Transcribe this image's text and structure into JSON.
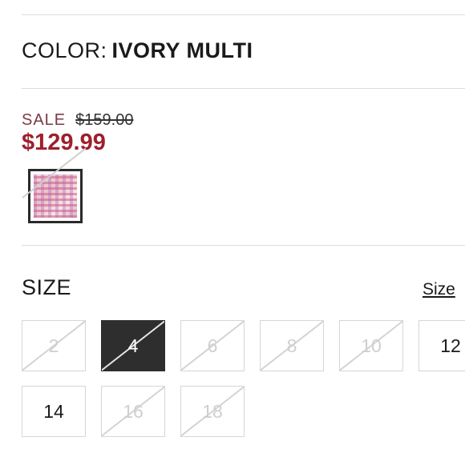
{
  "color": {
    "label": "COLOR:",
    "value": "IVORY MULTI"
  },
  "pricing": {
    "sale_label": "SALE",
    "original_price": "$159.00",
    "sale_price": "$129.99"
  },
  "swatch": {
    "name": "ivory-multi-swatch",
    "selected": true,
    "unavailable": true
  },
  "size": {
    "title": "SIZE",
    "guide_label": "Size",
    "options": [
      {
        "label": "2",
        "available": false,
        "selected": false
      },
      {
        "label": "4",
        "available": false,
        "selected": true
      },
      {
        "label": "6",
        "available": false,
        "selected": false
      },
      {
        "label": "8",
        "available": false,
        "selected": false
      },
      {
        "label": "10",
        "available": false,
        "selected": false
      },
      {
        "label": "12",
        "available": true,
        "selected": false
      },
      {
        "label": "14",
        "available": true,
        "selected": false
      },
      {
        "label": "16",
        "available": false,
        "selected": false
      },
      {
        "label": "18",
        "available": false,
        "selected": false
      }
    ]
  },
  "colors": {
    "sale_red": "#9e1f2b",
    "sale_label": "#7d3a47",
    "selected_bg": "#2e2e2e"
  }
}
